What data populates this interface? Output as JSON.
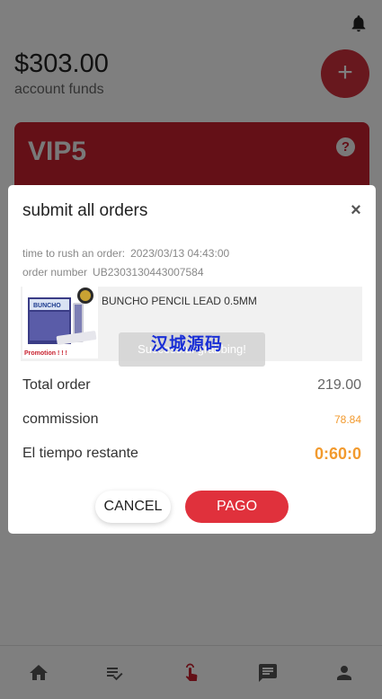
{
  "header": {
    "balance": "$303.00",
    "balance_label": "account funds",
    "bell_icon": "bell-icon",
    "add_icon": "plus-icon",
    "add_label": "+"
  },
  "vip": {
    "title": "VIP5",
    "help_label": "?"
  },
  "modal": {
    "title": "submit all orders",
    "close_label": "×",
    "time_label": "time to rush an order:",
    "time_value": "2023/03/13 04:43:00",
    "order_label": "order number",
    "order_value": "UB2303130443007584",
    "product": {
      "name": "BUNCHO PENCIL LEAD 0.5MM",
      "image_brand": "BUNCHO",
      "image_promo": "Promotion ! ! !"
    },
    "toast": "Successful grabbing!",
    "watermark": "汉城源码",
    "total_label": "Total order",
    "total_value": "219.00",
    "commission_label": "commission",
    "commission_value": "78.84",
    "remaining_label": "El tiempo restante",
    "remaining_value": "0:60:0",
    "cancel_label": "CANCEL",
    "pay_label": "PAGO"
  },
  "nav": {
    "items": [
      {
        "icon": "home-icon"
      },
      {
        "icon": "orders-list-icon"
      },
      {
        "icon": "grab-order-icon"
      },
      {
        "icon": "chat-icon"
      },
      {
        "icon": "profile-icon"
      }
    ]
  },
  "colors": {
    "brand_red": "#d0303c",
    "commission_orange": "#f29a2e"
  }
}
